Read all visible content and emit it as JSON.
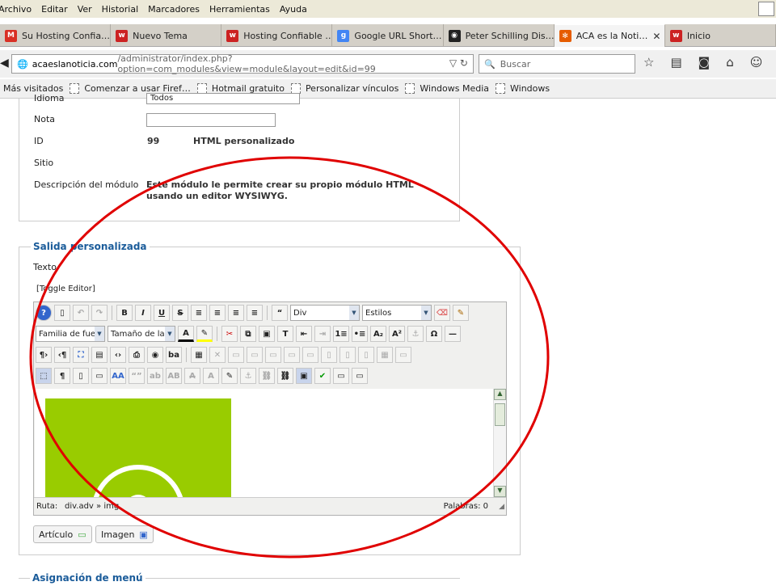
{
  "menu": [
    "Archivo",
    "Editar",
    "Ver",
    "Historial",
    "Marcadores",
    "Herramientas",
    "Ayuda"
  ],
  "tabs": [
    {
      "label": "Su Hosting Confia…",
      "icon": "gmail-icon",
      "color": "#d93025",
      "glyph": "M"
    },
    {
      "label": "Nuevo Tema",
      "icon": "webhost-icon",
      "color": "#cc2222",
      "glyph": "w"
    },
    {
      "label": "Hosting Confiable …",
      "icon": "webhost-icon",
      "color": "#cc2222",
      "glyph": "w"
    },
    {
      "label": "Google URL Short…",
      "icon": "google-icon",
      "color": "#4285f4",
      "glyph": "g"
    },
    {
      "label": "Peter Schilling Dis…",
      "icon": "disc-icon",
      "color": "#222222",
      "glyph": "◉"
    },
    {
      "label": "ACA es la Noti…",
      "icon": "joomla-icon",
      "color": "#e65c00",
      "glyph": "✻",
      "close": "✕"
    },
    {
      "label": "Inicio",
      "icon": "webhost-icon",
      "color": "#cc2222",
      "glyph": "w"
    }
  ],
  "url": {
    "host": "acaeslanoticia.com",
    "path": "/administrator/index.php?option=com_modules&view=module&layout=edit&id=99"
  },
  "search": {
    "placeholder": "Buscar"
  },
  "bookmarks": [
    "Más visitados",
    "Comenzar a usar Firef…",
    "Hotmail gratuito",
    "Personalizar vínculos",
    "Windows Media",
    "Windows"
  ],
  "form": {
    "idioma_label": "Idioma",
    "idioma_value": "Todos",
    "nota_label": "Nota",
    "id_label": "ID",
    "id_value": "99",
    "id_type": "HTML personalizado",
    "sitio_label": "Sitio",
    "desc_label": "Descripción del módulo",
    "desc_value": "Este módulo le permite crear su propio módulo HTML usando un editor WYSIWYG."
  },
  "output": {
    "legend": "Salida personalizada",
    "texto": "Texto",
    "toggle": "[Toggle Editor]",
    "format_select": "Div",
    "styles_select": "Estilos",
    "font_family": "Familia de fuen",
    "font_size": "Tamaño de la f",
    "path_label": "Ruta:",
    "path_value": "div.adv » img",
    "words": "Palabras: 0",
    "btn_article": "Artículo",
    "btn_image": "Imagen"
  },
  "menu_assign": {
    "legend": "Asignación de menú"
  },
  "colors": {
    "accent": "#1b5c9a",
    "green": "#99cc00",
    "circle": "#e00000"
  }
}
